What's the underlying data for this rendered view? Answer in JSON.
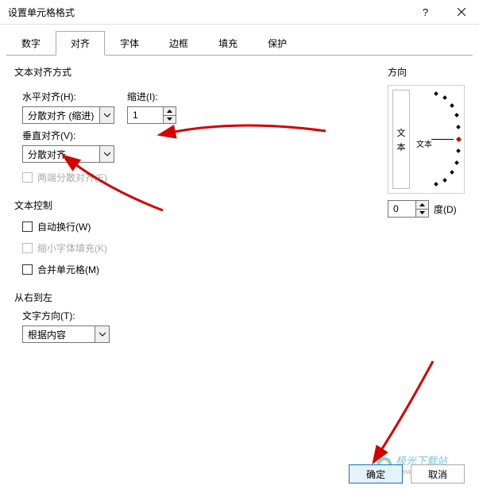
{
  "titlebar": {
    "title": "设置单元格格式"
  },
  "tabs": {
    "items": [
      "数字",
      "对齐",
      "字体",
      "边框",
      "填充",
      "保护"
    ],
    "active_index": 1
  },
  "alignment": {
    "section_label": "文本对齐方式",
    "h_label": "水平对齐(H):",
    "h_value": "分散对齐 (缩进)",
    "indent_label": "缩进(I):",
    "indent_value": "1",
    "v_label": "垂直对齐(V):",
    "v_value": "分散对齐",
    "justify_distributed_label": "两端分散对齐(E)"
  },
  "text_control": {
    "section_label": "文本控制",
    "wrap_label": "自动换行(W)",
    "shrink_label": "缩小字体填充(K)",
    "merge_label": "合并单元格(M)"
  },
  "rtl": {
    "section_label": "从右到左",
    "dir_label": "文字方向(T):",
    "dir_value": "根据内容"
  },
  "orientation": {
    "section_label": "方向",
    "vertical_text_1": "文",
    "vertical_text_2": "本",
    "center_text": "文本",
    "degree_value": "0",
    "degree_label": "度(D)"
  },
  "footer": {
    "ok": "确定",
    "cancel": "取消"
  },
  "watermark": {
    "text": "极光下载站",
    "url": "www.xz7.com"
  }
}
